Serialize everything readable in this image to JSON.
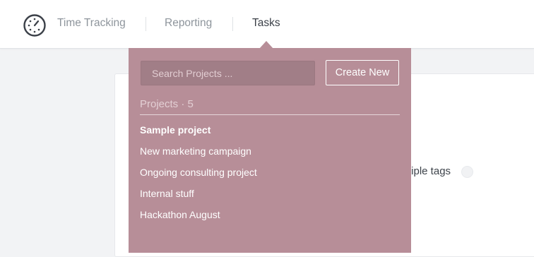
{
  "nav": {
    "items": [
      {
        "label": "Time Tracking",
        "active": false
      },
      {
        "label": "Reporting",
        "active": false
      },
      {
        "label": "Tasks",
        "active": true
      }
    ]
  },
  "dropdown": {
    "search_placeholder": "Search Projects ...",
    "create_label": "Create New",
    "projects_header": "Projects · 5",
    "projects": [
      "Sample project",
      "New marketing campaign",
      "Ongoing consulting project",
      "Internal stuff",
      "Hackathon August"
    ]
  },
  "background": {
    "tags_text": "tiple tags"
  },
  "colors": {
    "dropdown_bg": "#b78e98",
    "nav_active": "#3b4048",
    "nav_inactive": "#8e959c"
  }
}
